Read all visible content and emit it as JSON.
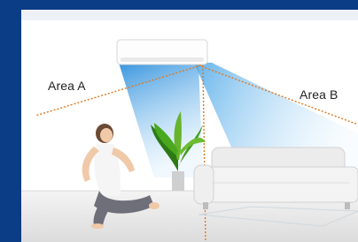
{
  "labels": {
    "area_a": "Area A",
    "area_b": "Area B"
  },
  "colors": {
    "border_blue": "#0b3c86",
    "airflow_blue": "#3fa0e6",
    "guide_orange": "#e0781e"
  },
  "icons": {
    "air_conditioner": "air-conditioner-icon",
    "plant": "plant-icon",
    "sofa": "sofa-icon",
    "woman": "person-icon"
  }
}
